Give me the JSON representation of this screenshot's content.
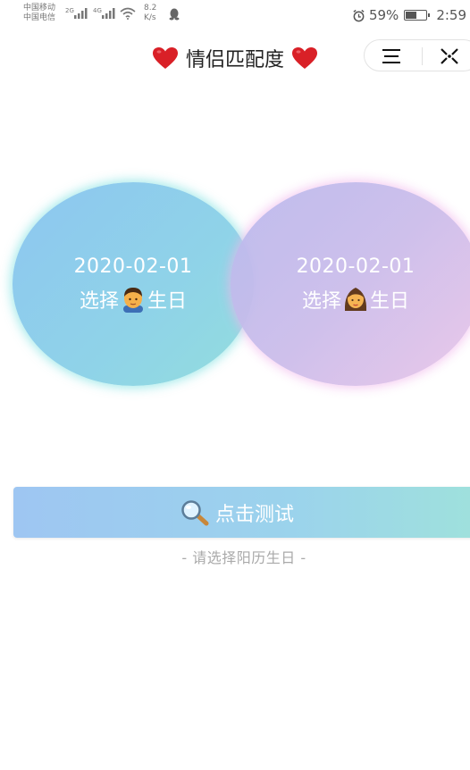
{
  "status_bar": {
    "carrier_1": "中国移动",
    "carrier_2": "中国电信",
    "net_1": "2G",
    "net_2": "4G",
    "speed_value": "8.2",
    "speed_unit": "K/s",
    "battery_percent": "59%",
    "battery_level": 0.59,
    "time": "2:59",
    "icons": [
      "signal-icon",
      "wifi-icon",
      "qq-icon",
      "alarm-icon",
      "battery-icon"
    ]
  },
  "header": {
    "title": "情侣匹配度",
    "icons": [
      "heart-icon",
      "menu-icon",
      "close-icon"
    ],
    "accent_color": "#d92027"
  },
  "male_circle": {
    "date": "2020-02-01",
    "label_before": "选择",
    "label_after": "生日",
    "icon": "man-face-icon"
  },
  "female_circle": {
    "date": "2020-02-01",
    "label_before": "选择",
    "label_after": "生日",
    "icon": "woman-face-icon"
  },
  "test_button": {
    "label": "点击测试",
    "icon": "magnifier-icon"
  },
  "hint": "- 请选择阳历生日 -"
}
